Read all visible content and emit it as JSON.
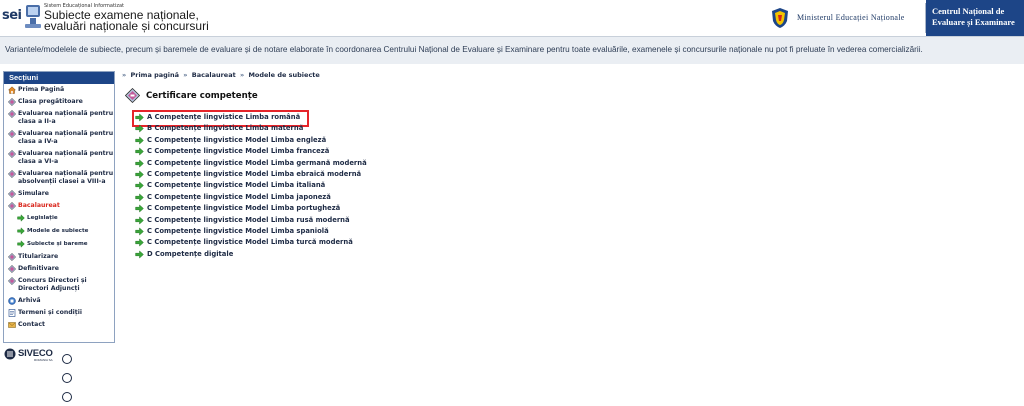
{
  "header": {
    "logo": {
      "brand": "sei",
      "small_text": "Sistem Educațional Informatizat",
      "title_line1": "Subiecte examene naționale,",
      "title_line2": "evaluări naționale și concursuri"
    },
    "ministry": "Ministerul Educației Naționale",
    "cnee_line1": "Centrul Național de",
    "cnee_line2": "Evaluare și Examinare"
  },
  "notice": "Variantele/modelele de subiecte, precum și baremele de evaluare și de notare elaborate în coordonarea Centrului Național de Evaluare și Examinare pentru toate evaluările, examenele și concursurile naționale nu pot fi preluate în vederea comercializării.",
  "sidebar": {
    "title": "Secțiuni",
    "items": [
      {
        "label": "Prima Pagină",
        "icon": "home-icon"
      },
      {
        "label": "Clasa pregătitoare",
        "icon": "diamond-icon"
      },
      {
        "label": "Evaluarea națională pentru clasa a II-a",
        "icon": "diamond-icon"
      },
      {
        "label": "Evaluarea națională pentru clasa a IV-a",
        "icon": "diamond-icon"
      },
      {
        "label": "Evaluarea națională pentru clasa a VI-a",
        "icon": "diamond-icon"
      },
      {
        "label": "Evaluarea națională pentru absolvenții clasei a VIII-a",
        "icon": "diamond-icon"
      },
      {
        "label": "Simulare",
        "icon": "diamond-icon"
      },
      {
        "label": "Bacalaureat",
        "icon": "diamond-icon",
        "active": true
      },
      {
        "label": "Legislație",
        "icon": "arrow-icon",
        "sub": true
      },
      {
        "label": "Modele de subiecte",
        "icon": "arrow-icon",
        "sub": true
      },
      {
        "label": "Subiecte și bareme",
        "icon": "arrow-icon",
        "sub": true
      },
      {
        "label": "Titularizare",
        "icon": "diamond-icon"
      },
      {
        "label": "Definitivare",
        "icon": "diamond-icon"
      },
      {
        "label": "Concurs Directori și Directori Adjuncți",
        "icon": "diamond-icon"
      },
      {
        "label": "Arhivă",
        "icon": "archive-icon"
      },
      {
        "label": "Termeni și condiții",
        "icon": "document-icon"
      },
      {
        "label": "Contact",
        "icon": "contact-icon"
      }
    ]
  },
  "footer_logo": {
    "word": "SIVECO",
    "sub": "ROMANIA SA"
  },
  "breadcrumb": [
    "Prima pagină",
    "Bacalaureat",
    "Modele de subiecte"
  ],
  "breadcrumb_sep": "»",
  "section": {
    "title": "Certificare competențe",
    "links": [
      "A Competențe lingvistice Limba română",
      "B Competențe lingvistice Limba maternă",
      "C Competențe lingvistice Model Limba engleză",
      "C Competențe lingvistice Model Limba franceză",
      "C Competențe lingvistice Model Limba germană modernă",
      "C Competențe lingvistice Model Limba ebraică modernă",
      "C Competențe lingvistice Model Limba italiană",
      "C Competențe lingvistice Model Limba japoneză",
      "C Competențe lingvistice Model Limba portugheză",
      "C Competențe lingvistice Model Limba rusă modernă",
      "C Competențe lingvistice Model Limba spaniolă",
      "C Competențe lingvistice Model Limba turcă modernă",
      "D Competențe digitale"
    ],
    "highlighted_index": 0
  },
  "colors": {
    "brand_blue": "#1d4587",
    "active_red": "#d9261c",
    "highlight_border": "#e5242a",
    "link_arrow": "#3aa63a"
  }
}
